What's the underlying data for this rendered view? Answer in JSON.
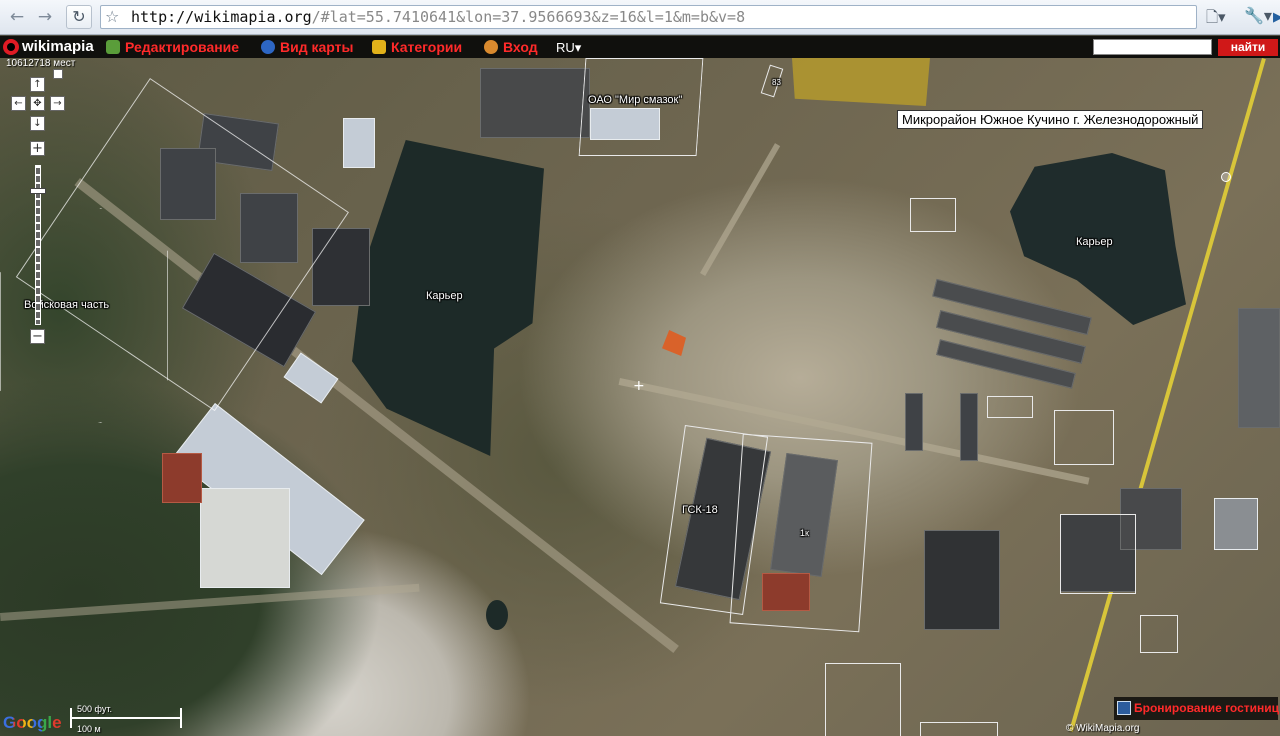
{
  "browser": {
    "back": "←",
    "forward": "→",
    "reload": "↻",
    "star": "☆",
    "url_host": "http://wikimapia.org",
    "url_rest": "/#lat=55.7410641&lon=37.9566693&z=16&l=1&m=b&v=8",
    "go": "▶",
    "page_menu": "🗋▾",
    "wrench": "🔧▾"
  },
  "wikimapia_bar": {
    "logo": "wikimapia",
    "menu": [
      {
        "label": "Редактирование",
        "icon": "edit-icon"
      },
      {
        "label": "Вид карты",
        "icon": "map-view-icon"
      },
      {
        "label": "Категории",
        "icon": "categories-icon"
      },
      {
        "label": "Вход",
        "icon": "login-icon"
      }
    ],
    "lang": "RU▾",
    "search_button": "найти",
    "search_value": ""
  },
  "map": {
    "place_count": "10612718 мест",
    "tooltip": "Микрорайон Южное Кучино г. Железнодорожный",
    "labels": {
      "company": "ОАО \"Мир смазок\"",
      "quarry_left": "Карьер",
      "quarry_right": "Карьер",
      "military": "Войсковая часть",
      "garage": "ГСК-18",
      "number": "83",
      "small_1k": "1к"
    },
    "controls": {
      "up": "↑",
      "left": "←",
      "center": "✥",
      "right": "→",
      "down": "↓",
      "zoom_in": "+",
      "zoom_out": "−"
    },
    "google": "Google",
    "scale_ft": "500 фут.",
    "scale_m": "100 м",
    "copyright": "© WikiMapia.org",
    "hotel_booking": "Бронирование гостиниц"
  },
  "colors": {
    "brand_red": "#ff2a2a",
    "highlight_yellow": "#bea028"
  }
}
